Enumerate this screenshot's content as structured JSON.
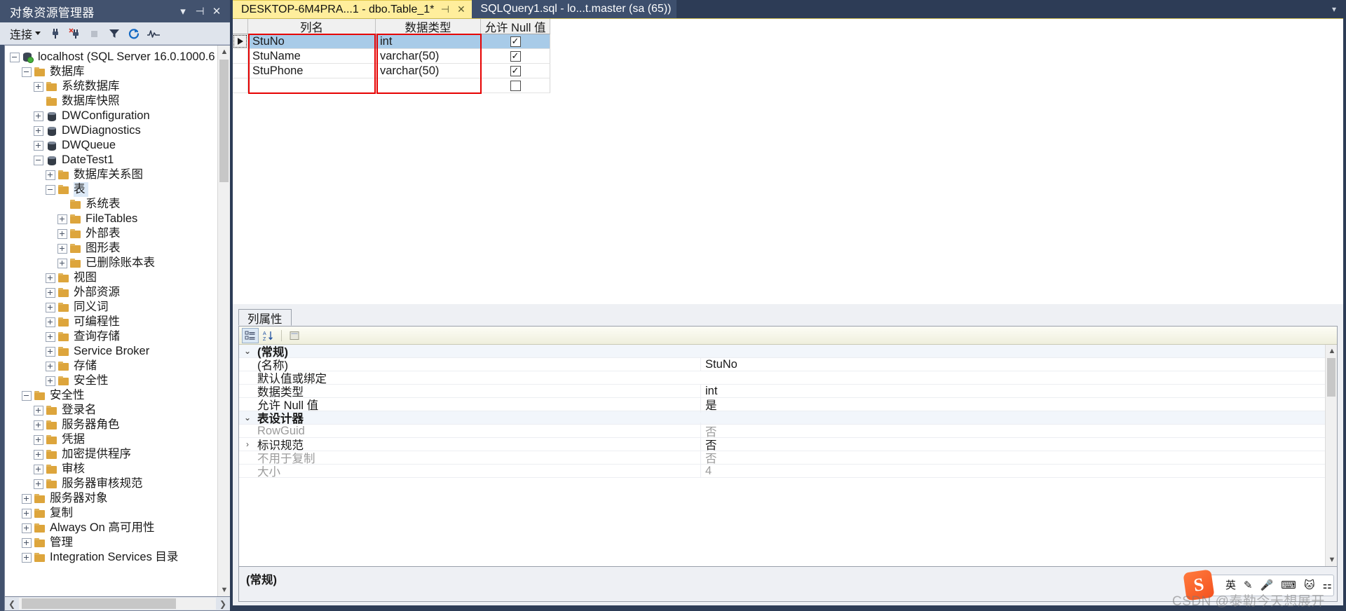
{
  "object_explorer": {
    "title": "对象资源管理器",
    "titlebar_icons": [
      "chevron-down-icon",
      "pin-icon",
      "close-icon"
    ],
    "toolbar": {
      "connect_label": "连接",
      "buttons": [
        "connect-icon",
        "disconnect-icon",
        "stop-icon",
        "filter-icon",
        "refresh-icon",
        "activity-monitor-icon"
      ]
    },
    "tree": [
      {
        "label": "localhost (SQL Server 16.0.1000.6",
        "indent": 0,
        "icon": "server-icon",
        "state": "expanded"
      },
      {
        "label": "数据库",
        "indent": 1,
        "icon": "folder-icon",
        "state": "expanded"
      },
      {
        "label": "系统数据库",
        "indent": 2,
        "icon": "folder-icon",
        "state": "collapsed"
      },
      {
        "label": "数据库快照",
        "indent": 2,
        "icon": "folder-icon",
        "state": "leaf"
      },
      {
        "label": "DWConfiguration",
        "indent": 2,
        "icon": "database-icon",
        "state": "collapsed"
      },
      {
        "label": "DWDiagnostics",
        "indent": 2,
        "icon": "database-icon",
        "state": "collapsed"
      },
      {
        "label": "DWQueue",
        "indent": 2,
        "icon": "database-icon",
        "state": "collapsed"
      },
      {
        "label": "DateTest1",
        "indent": 2,
        "icon": "database-icon",
        "state": "expanded"
      },
      {
        "label": "数据库关系图",
        "indent": 3,
        "icon": "folder-icon",
        "state": "collapsed"
      },
      {
        "label": "表",
        "indent": 3,
        "icon": "folder-icon",
        "state": "expanded",
        "selected": true
      },
      {
        "label": "系统表",
        "indent": 4,
        "icon": "folder-icon",
        "state": "leaf"
      },
      {
        "label": "FileTables",
        "indent": 4,
        "icon": "folder-icon",
        "state": "collapsed"
      },
      {
        "label": "外部表",
        "indent": 4,
        "icon": "folder-icon",
        "state": "collapsed"
      },
      {
        "label": "图形表",
        "indent": 4,
        "icon": "folder-icon",
        "state": "collapsed"
      },
      {
        "label": "已删除账本表",
        "indent": 4,
        "icon": "folder-icon",
        "state": "collapsed"
      },
      {
        "label": "视图",
        "indent": 3,
        "icon": "folder-icon",
        "state": "collapsed"
      },
      {
        "label": "外部资源",
        "indent": 3,
        "icon": "folder-icon",
        "state": "collapsed"
      },
      {
        "label": "同义词",
        "indent": 3,
        "icon": "folder-icon",
        "state": "collapsed"
      },
      {
        "label": "可编程性",
        "indent": 3,
        "icon": "folder-icon",
        "state": "collapsed"
      },
      {
        "label": "查询存储",
        "indent": 3,
        "icon": "folder-icon",
        "state": "collapsed"
      },
      {
        "label": "Service Broker",
        "indent": 3,
        "icon": "folder-icon",
        "state": "collapsed"
      },
      {
        "label": "存储",
        "indent": 3,
        "icon": "folder-icon",
        "state": "collapsed"
      },
      {
        "label": "安全性",
        "indent": 3,
        "icon": "folder-icon",
        "state": "collapsed"
      },
      {
        "label": "安全性",
        "indent": 1,
        "icon": "folder-icon",
        "state": "expanded"
      },
      {
        "label": "登录名",
        "indent": 2,
        "icon": "folder-icon",
        "state": "collapsed"
      },
      {
        "label": "服务器角色",
        "indent": 2,
        "icon": "folder-icon",
        "state": "collapsed"
      },
      {
        "label": "凭据",
        "indent": 2,
        "icon": "folder-icon",
        "state": "collapsed"
      },
      {
        "label": "加密提供程序",
        "indent": 2,
        "icon": "folder-icon",
        "state": "collapsed"
      },
      {
        "label": "审核",
        "indent": 2,
        "icon": "folder-icon",
        "state": "collapsed"
      },
      {
        "label": "服务器审核规范",
        "indent": 2,
        "icon": "folder-icon",
        "state": "collapsed"
      },
      {
        "label": "服务器对象",
        "indent": 1,
        "icon": "folder-icon",
        "state": "collapsed"
      },
      {
        "label": "复制",
        "indent": 1,
        "icon": "folder-icon",
        "state": "collapsed"
      },
      {
        "label": "Always On 高可用性",
        "indent": 1,
        "icon": "folder-icon",
        "state": "collapsed"
      },
      {
        "label": "管理",
        "indent": 1,
        "icon": "folder-icon",
        "state": "collapsed"
      },
      {
        "label": "Integration Services 目录",
        "indent": 1,
        "icon": "folder-icon",
        "state": "collapsed"
      }
    ]
  },
  "tabs": [
    {
      "label": "DESKTOP-6M4PRA...1 - dbo.Table_1*",
      "active": true,
      "pin": "⊣",
      "close": "✕"
    },
    {
      "label": "SQLQuery1.sql - lo...t.master (sa (65))",
      "active": false
    }
  ],
  "designer": {
    "columns": [
      "列名",
      "数据类型",
      "允许 Null 值"
    ],
    "rows": [
      {
        "name": "StuNo",
        "type": "int",
        "allow_null": true,
        "selected": true
      },
      {
        "name": "StuName",
        "type": "varchar(50)",
        "allow_null": true,
        "selected": false
      },
      {
        "name": "StuPhone",
        "type": "varchar(50)",
        "allow_null": true,
        "selected": false
      },
      {
        "name": "",
        "type": "",
        "allow_null": false,
        "selected": false
      }
    ],
    "checkmark": "✓",
    "highlight_color": "#e60000"
  },
  "properties": {
    "tab_label": "列属性",
    "toolbar_buttons": [
      "categorized-icon",
      "alphabetical-icon",
      "property-pages-icon"
    ],
    "rows": [
      {
        "name": "(常规)",
        "value": "",
        "kind": "category",
        "expander": "⌄"
      },
      {
        "name": "(名称)",
        "value": "StuNo",
        "kind": "item"
      },
      {
        "name": "默认值或绑定",
        "value": "",
        "kind": "item"
      },
      {
        "name": "数据类型",
        "value": "int",
        "kind": "item"
      },
      {
        "name": "允许 Null 值",
        "value": "是",
        "kind": "item"
      },
      {
        "name": "表设计器",
        "value": "",
        "kind": "category",
        "expander": "⌄"
      },
      {
        "name": "RowGuid",
        "value": "否",
        "kind": "item",
        "dim": true
      },
      {
        "name": "标识规范",
        "value": "否",
        "kind": "item",
        "expander": "›"
      },
      {
        "name": "不用于复制",
        "value": "否",
        "kind": "item",
        "dim": true
      },
      {
        "name": "大小",
        "value": "4",
        "kind": "item",
        "dim": true
      }
    ],
    "description_title": "(常规)"
  },
  "ime": {
    "logo_text": "S",
    "items": [
      "英",
      "✎",
      "🎤",
      "⌨",
      "🐱",
      "⚏"
    ]
  },
  "watermark": "CSDN @泰勒今天想展开"
}
